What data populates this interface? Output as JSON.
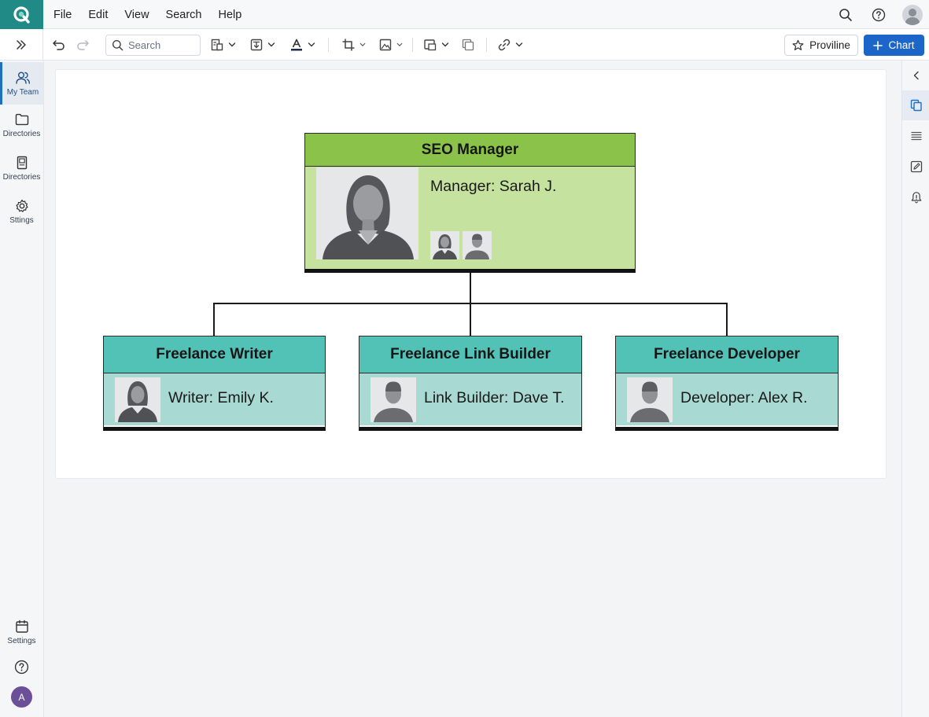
{
  "menubar": {
    "items": [
      "File",
      "Edit",
      "View",
      "Search",
      "Help"
    ]
  },
  "toolbar": {
    "search_placeholder": "Search",
    "proviline_label": "Proviline",
    "chart_label": "Chart"
  },
  "sidebar": {
    "items": [
      {
        "label": "My Team",
        "icon": "people-icon",
        "active": true
      },
      {
        "label": "Directories",
        "icon": "folder-icon"
      },
      {
        "label": "Directories",
        "icon": "document-icon"
      },
      {
        "label": "Sttings",
        "icon": "gear-icon"
      }
    ],
    "bottom": [
      {
        "label": "Settings",
        "icon": "calendar-icon"
      }
    ],
    "avatar_initial": "A"
  },
  "org_chart": {
    "root": {
      "title": "SEO Manager",
      "person": "Manager: Sarah J.",
      "color": "#8bc34a"
    },
    "children": [
      {
        "title": "Freelance Writer",
        "person": "Writer: Emily K.",
        "gender": "female"
      },
      {
        "title": "Freelance Link Builder",
        "person": "Link Builder: Dave T.",
        "gender": "male"
      },
      {
        "title": "Freelance Developer",
        "person": "Developer: Alex R.",
        "gender": "male"
      }
    ],
    "child_color": "#52c1b6"
  },
  "colors": {
    "accent": "#1d66c9",
    "brand": "#1f8a86"
  }
}
